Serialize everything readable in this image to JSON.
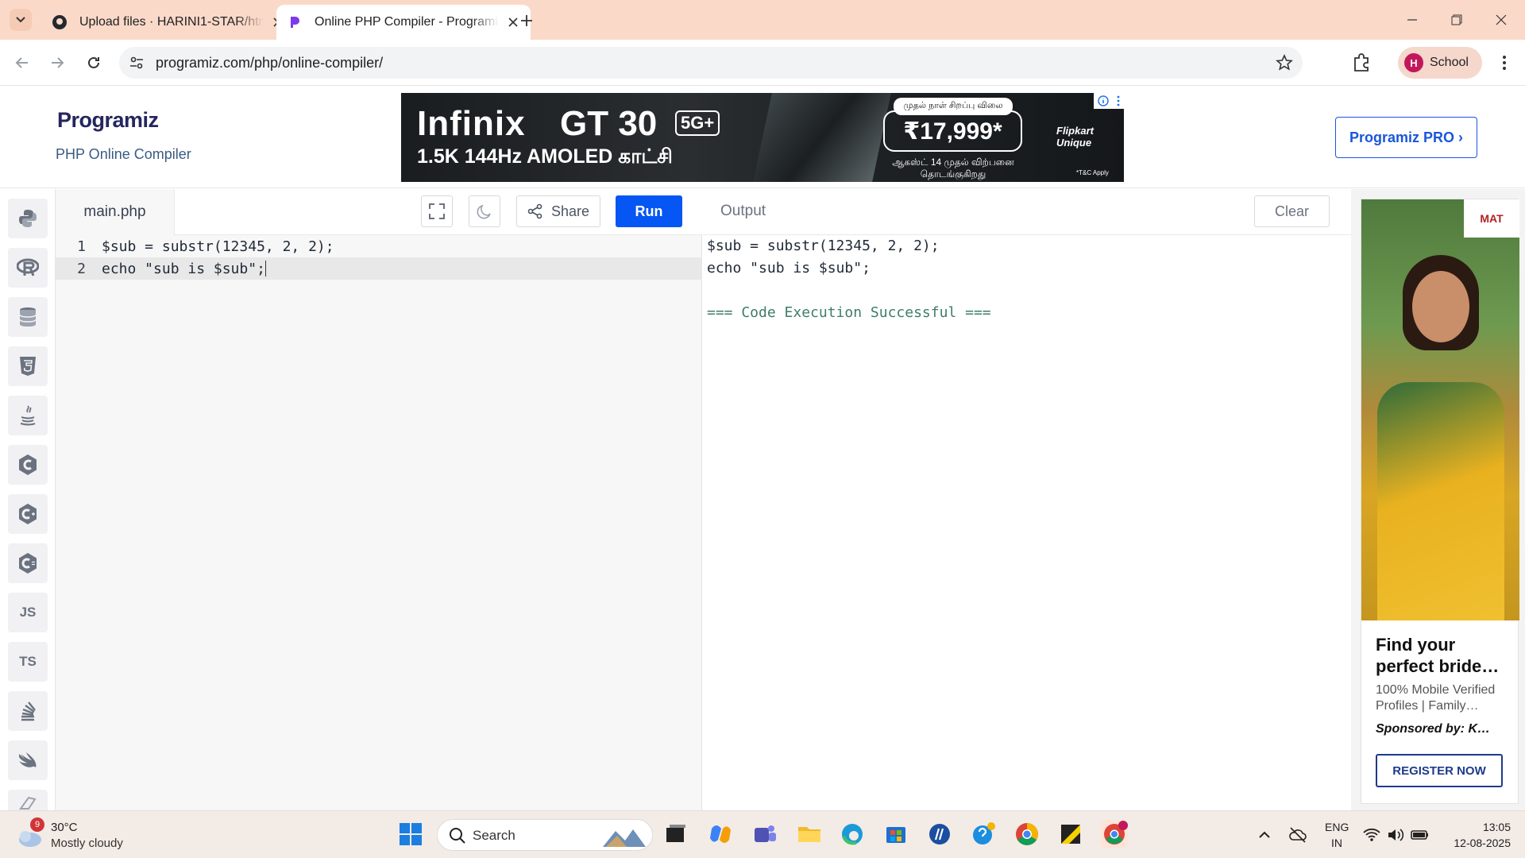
{
  "browser": {
    "tabs": [
      {
        "title": "Upload files · HARINI1-STAR/htm",
        "active": false,
        "favicon": "github-icon"
      },
      {
        "title": "Online PHP Compiler - Programiz",
        "active": true,
        "favicon": "programiz-icon"
      }
    ],
    "url": "programiz.com/php/online-compiler/",
    "profile_initial": "H",
    "profile_label": "School"
  },
  "header": {
    "logo": "Programiz",
    "subtitle": "PHP Online Compiler",
    "pro_button": "Programiz PRO ›",
    "banner_ad": {
      "brand": "Infinix",
      "model": "GT 30",
      "badge": "5G+",
      "tagline": "1.5K 144Hz AMOLED காட்சி",
      "price_tag": "முதல் நாள் சிறப்பு விலை",
      "price": "₹17,999*",
      "date_line": "ஆகஸ்ட் 14 முதல் விற்பனை தொடங்குகிறது",
      "partner": "Flipkart Unique",
      "terms": "*T&C Apply"
    }
  },
  "rail": {
    "items": [
      {
        "icon": "python-icon",
        "label": ""
      },
      {
        "icon": "r-icon",
        "label": ""
      },
      {
        "icon": "database-icon",
        "label": ""
      },
      {
        "icon": "html5-icon",
        "label": ""
      },
      {
        "icon": "java-icon",
        "label": ""
      },
      {
        "icon": "c-icon",
        "label": ""
      },
      {
        "icon": "cpp-icon",
        "label": ""
      },
      {
        "icon": "csharp-icon",
        "label": ""
      },
      {
        "icon": "js-icon",
        "label": "JS"
      },
      {
        "icon": "ts-icon",
        "label": "TS"
      },
      {
        "icon": "stack-icon",
        "label": ""
      },
      {
        "icon": "swift-icon",
        "label": ""
      }
    ]
  },
  "editor": {
    "filename": "main.php",
    "share_label": "Share",
    "run_label": "Run",
    "lines": [
      {
        "num": "1",
        "text": "$sub = substr(12345, 2, 2);"
      },
      {
        "num": "2",
        "text": "echo \"sub is $sub\";"
      }
    ]
  },
  "output": {
    "label": "Output",
    "clear_label": "Clear",
    "lines": [
      "$sub = substr(12345, 2, 2);",
      "echo \"sub is $sub\";",
      "",
      "=== Code Execution Successful ==="
    ]
  },
  "side_ad": {
    "brand_short": "MAT",
    "title": "Find your perfect bride…",
    "description": "100% Mobile Verified Profiles | Family…",
    "sponsor": "Sponsored by: K…",
    "cta": "REGISTER NOW"
  },
  "taskbar": {
    "weather_badge": "9",
    "temperature": "30°C",
    "condition": "Mostly cloudy",
    "search_label": "Search",
    "lang_line1": "ENG",
    "lang_line2": "IN",
    "time": "13:05",
    "date": "12-08-2025"
  }
}
